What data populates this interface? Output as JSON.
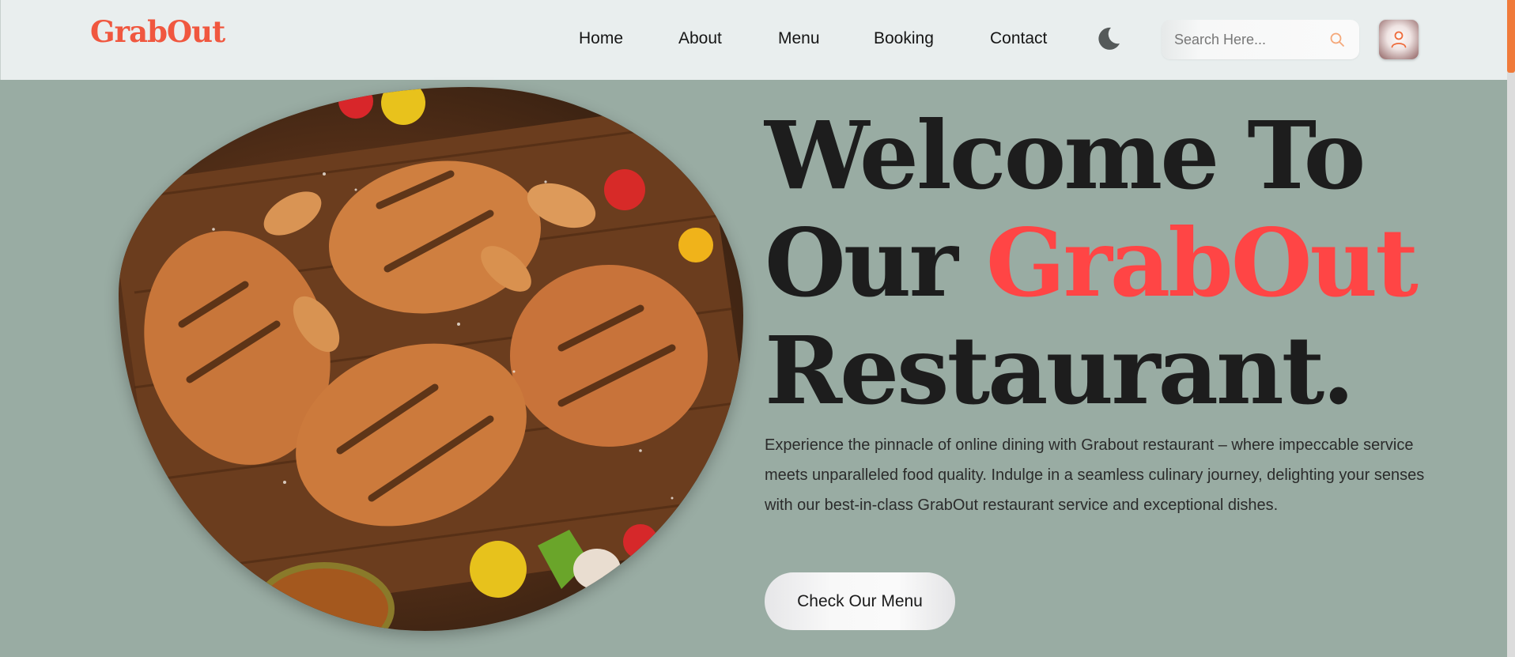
{
  "header": {
    "brand": "GrabOut",
    "nav": [
      {
        "id": "home",
        "label": "Home"
      },
      {
        "id": "about",
        "label": "About"
      },
      {
        "id": "menu",
        "label": "Menu"
      },
      {
        "id": "booking",
        "label": "Booking"
      },
      {
        "id": "contact",
        "label": "Contact"
      }
    ],
    "search": {
      "placeholder": "Search Here...",
      "value": ""
    },
    "theme_icon": "moon-icon",
    "search_icon": "search-icon",
    "user_icon": "user-icon"
  },
  "hero": {
    "title_line1": "Welcome To",
    "title_line2_prefix": "Our ",
    "title_highlight": "GrabOut",
    "title_line3": "Restaurant.",
    "description": "Experience the pinnacle of online dining with Grabout restaurant – where impeccable service meets unparalleled food quality. Indulge in a seamless culinary journey, delighting your senses with our best-in-class GrabOut restaurant service and exceptional dishes.",
    "cta_label": "Check Our Menu",
    "image_icon": "grilled-chicken-image"
  },
  "colors": {
    "brand": "#f0573f",
    "highlight": "#ff4545",
    "hero_bg": "#99aca3",
    "header_bg": "#e9eeee",
    "scroll_accent": "#f07a3a"
  }
}
